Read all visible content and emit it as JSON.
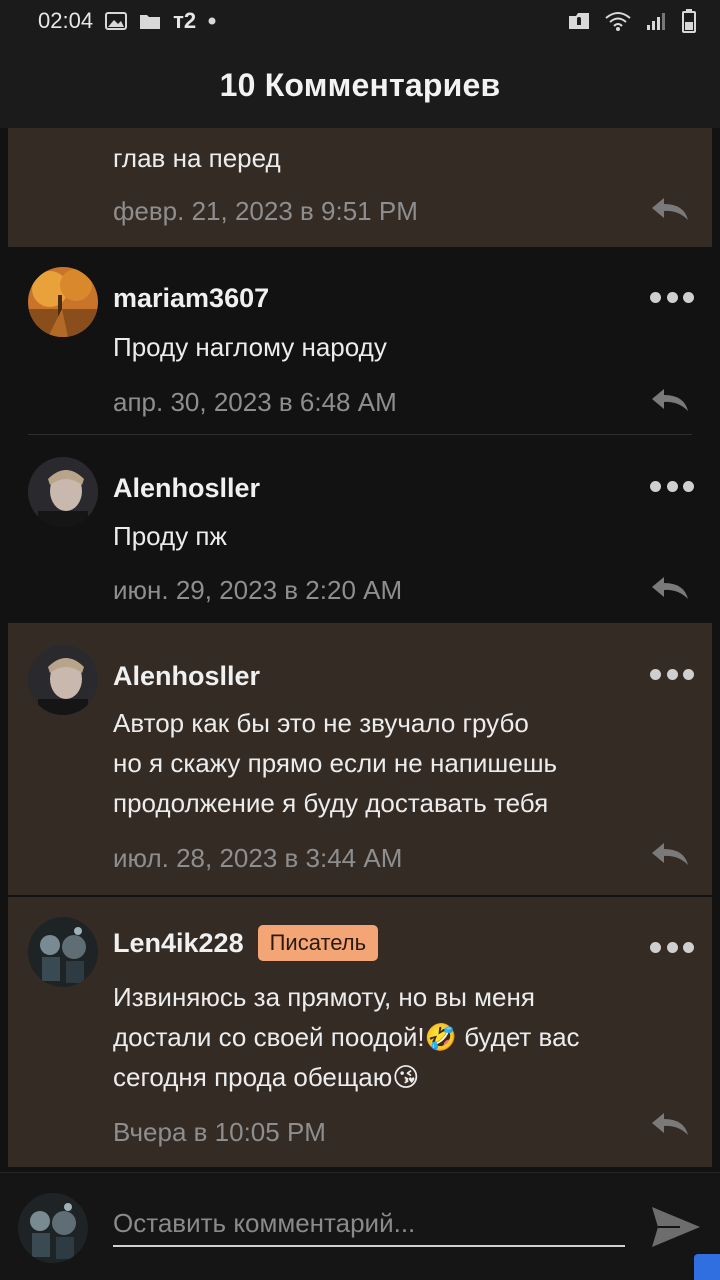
{
  "status_bar": {
    "time": "02:04",
    "carrier": "т2"
  },
  "header": {
    "title": "10 Комментариев"
  },
  "comments": [
    {
      "text": "глав на перед",
      "date": "февр. 21, 2023 в 9:51 PM"
    },
    {
      "author": "mariam3607",
      "text": "Проду наглому народу",
      "date": "апр. 30, 2023 в 6:48 AM"
    },
    {
      "author": "Alenhosller",
      "text": "Проду пж",
      "date": "июн. 29, 2023 в 2:20 AM"
    },
    {
      "author": "Alenhosller",
      "text_lines": [
        "Автор как бы это не звучало грубо",
        "но я скажу прямо если не напишешь",
        "продолжение я буду доставать тебя"
      ],
      "date": "июл. 28, 2023 в 3:44 AM"
    },
    {
      "author": "Len4ik228",
      "badge": "Писатель",
      "text_lines": [
        "Извиняюсь за прямоту, но вы меня",
        "достали со своей поодой!🤣 будет вас",
        "сегодня прода обещаю😘"
      ],
      "date": "Вчера в 10:05 PM"
    }
  ],
  "composer": {
    "placeholder": "Оставить комментарий..."
  },
  "colors": {
    "highlight_bg": "#342b25",
    "badge_bg": "#f4a576",
    "background": "#121212"
  }
}
